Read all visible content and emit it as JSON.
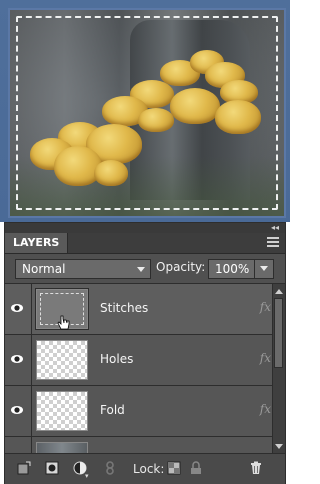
{
  "panel": {
    "title": "LAYERS"
  },
  "controls": {
    "blend_mode": "Normal",
    "opacity_label": "Opacity:",
    "opacity_value": "100%"
  },
  "layers": [
    {
      "name": "Stitches",
      "fx": "fx",
      "thumbnail": "gray-stitched",
      "visible": true,
      "selected": true
    },
    {
      "name": "Holes",
      "fx": "fx",
      "thumbnail": "transparent",
      "visible": true,
      "selected": false
    },
    {
      "name": "Fold",
      "fx": "fx",
      "thumbnail": "transparent",
      "visible": true,
      "selected": false
    },
    {
      "name": "",
      "fx": "",
      "thumbnail": "photo",
      "visible": true,
      "selected": false
    }
  ],
  "footer": {
    "lock_label": "Lock:"
  },
  "icons": {
    "eye": "eye-icon",
    "panel_menu": "panel-menu-icon",
    "collapse": "double-chevron-icon",
    "new_layer": "new-layer-icon",
    "mask": "layer-mask-icon",
    "adjustment": "adjustment-layer-icon",
    "link": "link-icon",
    "lock_transparent": "lock-transparent-icon",
    "lock_all": "lock-icon",
    "delete": "trash-icon"
  },
  "colors": {
    "panel_bg": "#505050",
    "preview_bg": "#4f6f9b"
  }
}
